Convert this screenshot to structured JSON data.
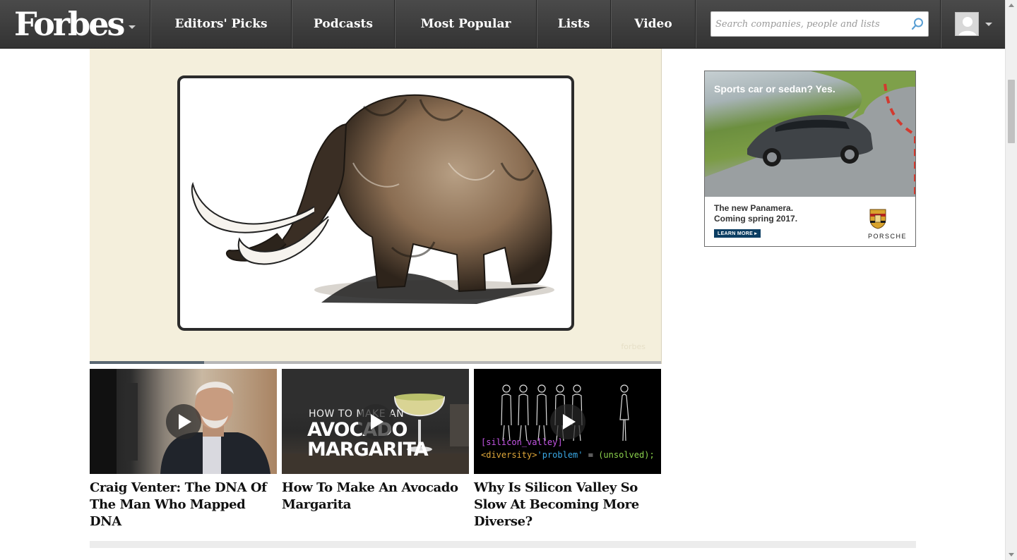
{
  "header": {
    "logo_text": "Forbes",
    "nav": [
      {
        "label": "Editors' Picks"
      },
      {
        "label": "Podcasts"
      },
      {
        "label": "Most Popular"
      },
      {
        "label": "Lists"
      },
      {
        "label": "Video"
      }
    ],
    "search": {
      "placeholder": "Search companies, people and lists",
      "value": ""
    },
    "icons": {
      "logo_dropdown": "chevron-down-icon",
      "search": "search-icon",
      "avatar": "user-avatar-icon",
      "account_dropdown": "chevron-down-icon"
    }
  },
  "player": {
    "illustration": "woolly-mammoth-sketch",
    "progress": 0.2,
    "colors": {
      "background": "#f4efdc",
      "progress_fill": "#5a6772",
      "progress_track": "#b7b7b7"
    }
  },
  "related_videos": [
    {
      "title": "Craig Venter: The DNA Of The Man Who Mapped DNA",
      "thumbnail": "portrait-thumbnail",
      "overlay": []
    },
    {
      "title": "How To Make An Avocado Margarita",
      "thumbnail": "cocktail-thumbnail",
      "overlay": [
        "HOW TO MAKE AN",
        "AVOCADO",
        "MARGARITA"
      ]
    },
    {
      "title": "Why Is Silicon Valley So Slow At Becoming More Diverse?",
      "thumbnail": "silhouettes-thumbnail",
      "code_line1": "[silicon_valley]",
      "code_line2": {
        "tag": "<diversity>",
        "str": "'problem'",
        "eq": " = ",
        "fn": "(unsolved);"
      }
    }
  ],
  "ad": {
    "headline": "Sports car or sedan?  Yes.",
    "copy_line1": "The new Panamera.",
    "copy_line2": "Coming spring 2017.",
    "cta": "LEARN MORE ▸",
    "brand": "PORSCHE",
    "colors": {
      "cta_bg": "#0c3e63"
    }
  },
  "theme": {
    "nav_bg": "#3d3d3d",
    "accent": "#5a9fd4"
  }
}
